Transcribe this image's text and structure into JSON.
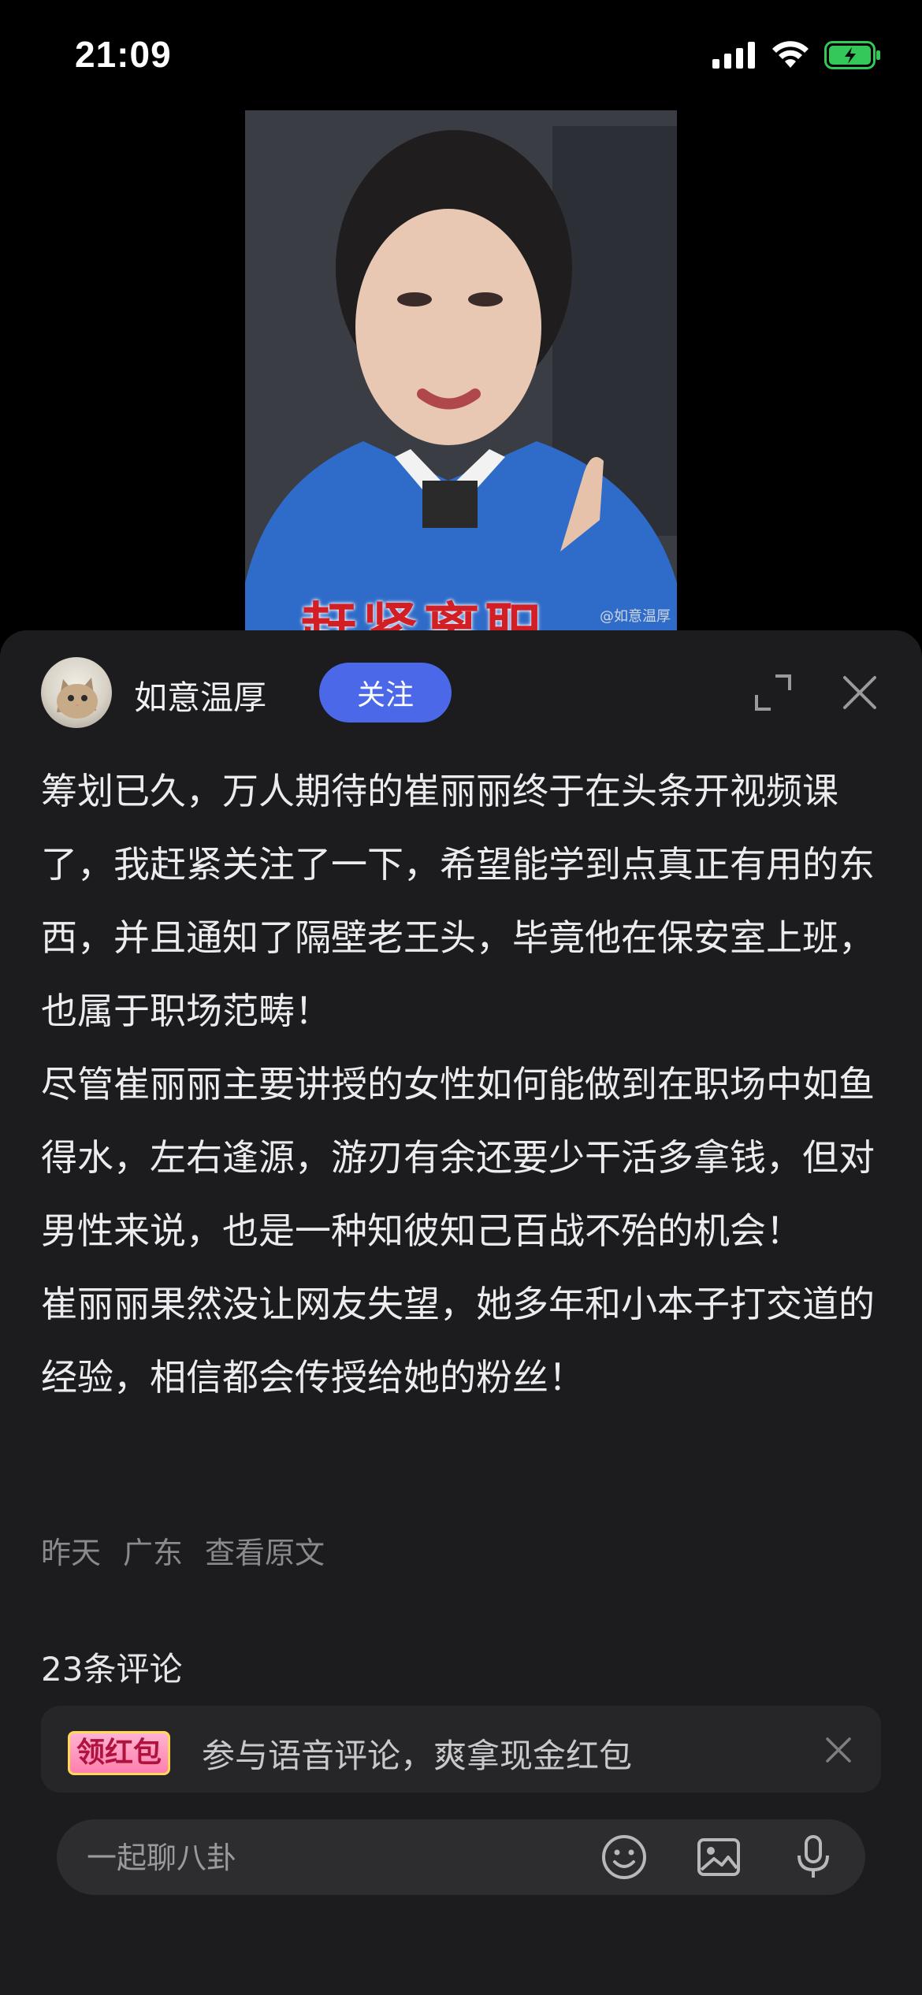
{
  "status_bar": {
    "time": "21:09",
    "battery_color": "#34c759"
  },
  "video": {
    "caption": "赶紧离职",
    "watermark": "@如意温厚"
  },
  "author": {
    "name": "如意温厚",
    "follow_label": "关注"
  },
  "post": {
    "paragraphs": [
      "筹划已久，万人期待的崔丽丽终于在头条开视频课了，我赶紧关注了一下，希望能学到点真正有用的东西，并且通知了隔壁老王头，毕竟他在保安室上班，也属于职场范畴！",
      "尽管崔丽丽主要讲授的女性如何能做到在职场中如鱼得水，左右逢源，游刃有余还要少干活多拿钱，但对男性来说，也是一种知彼知己百战不殆的机会！",
      "崔丽丽果然没让网友失望，她多年和小本子打交道的经验，相信都会传授给她的粉丝！"
    ],
    "time": "昨天",
    "location": "广东",
    "view_original": "查看原文"
  },
  "comments": {
    "count_label": "23条评论"
  },
  "promo": {
    "badge": "领红包",
    "text": "参与语音评论，爽拿现金红包"
  },
  "input": {
    "placeholder": "一起聊八卦"
  },
  "icons": [
    "expand-icon",
    "close-icon",
    "emoji-icon",
    "image-icon",
    "microphone-icon"
  ],
  "colors": {
    "follow_button": "#4a68e8",
    "sheet_background": "#1c1c1e"
  }
}
